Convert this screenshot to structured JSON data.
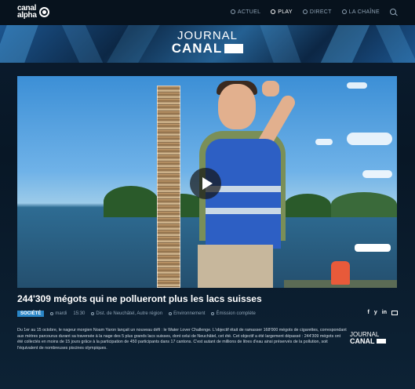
{
  "header": {
    "logo_text_line1": "canal",
    "logo_text_line2": "alpha",
    "nav": [
      {
        "label": "ACTUEL",
        "icon": "circle-icon",
        "active": false
      },
      {
        "label": "PLAY",
        "icon": "play-icon",
        "active": true
      },
      {
        "label": "DIRECT",
        "icon": "live-icon",
        "active": false
      },
      {
        "label": "LA CHAÎNE",
        "icon": "circle-icon",
        "active": false
      }
    ]
  },
  "banner": {
    "line1": "JOURNAL",
    "line2": "CANAL"
  },
  "article": {
    "title": "244'309 mégots qui ne pollueront plus les lacs suisses",
    "category": "SOCIÉTÉ",
    "date": "mardi",
    "time": "15:30",
    "region": "Dist. de Neuchâtel, Autre région",
    "topic": "Environnement",
    "format": "Émission complète",
    "body": "Du 1er au 15 octobre, le nageur morgien Noam Yaron lançait un nouveau défi : le Water Lover Challenge. L'objectif était de ramasser 168'000 mégots de cigarettes, correspondant aux mètres parcourus durant sa traversée à la nage des 5 plus grands lacs suisses, dont celui de Neuchâtel, cet été. Cet objectif a été largement dépassé : 244'309 mégots ont été collectés en moins de 15 jours grâce à la participation de 450 participants dans 17 cantons. C'est autant de millions de litres d'eau ainsi préservés de la pollution, soit l'équivalent de nombreuses piscines olympiques."
  },
  "social": {
    "facebook": "f",
    "twitter": "y",
    "linkedin": "in"
  },
  "footer_logo": {
    "line1": "JOURNAL",
    "line2": "CANAL"
  },
  "colors": {
    "accent": "#2a86c7",
    "background": "#0a1a2a"
  }
}
